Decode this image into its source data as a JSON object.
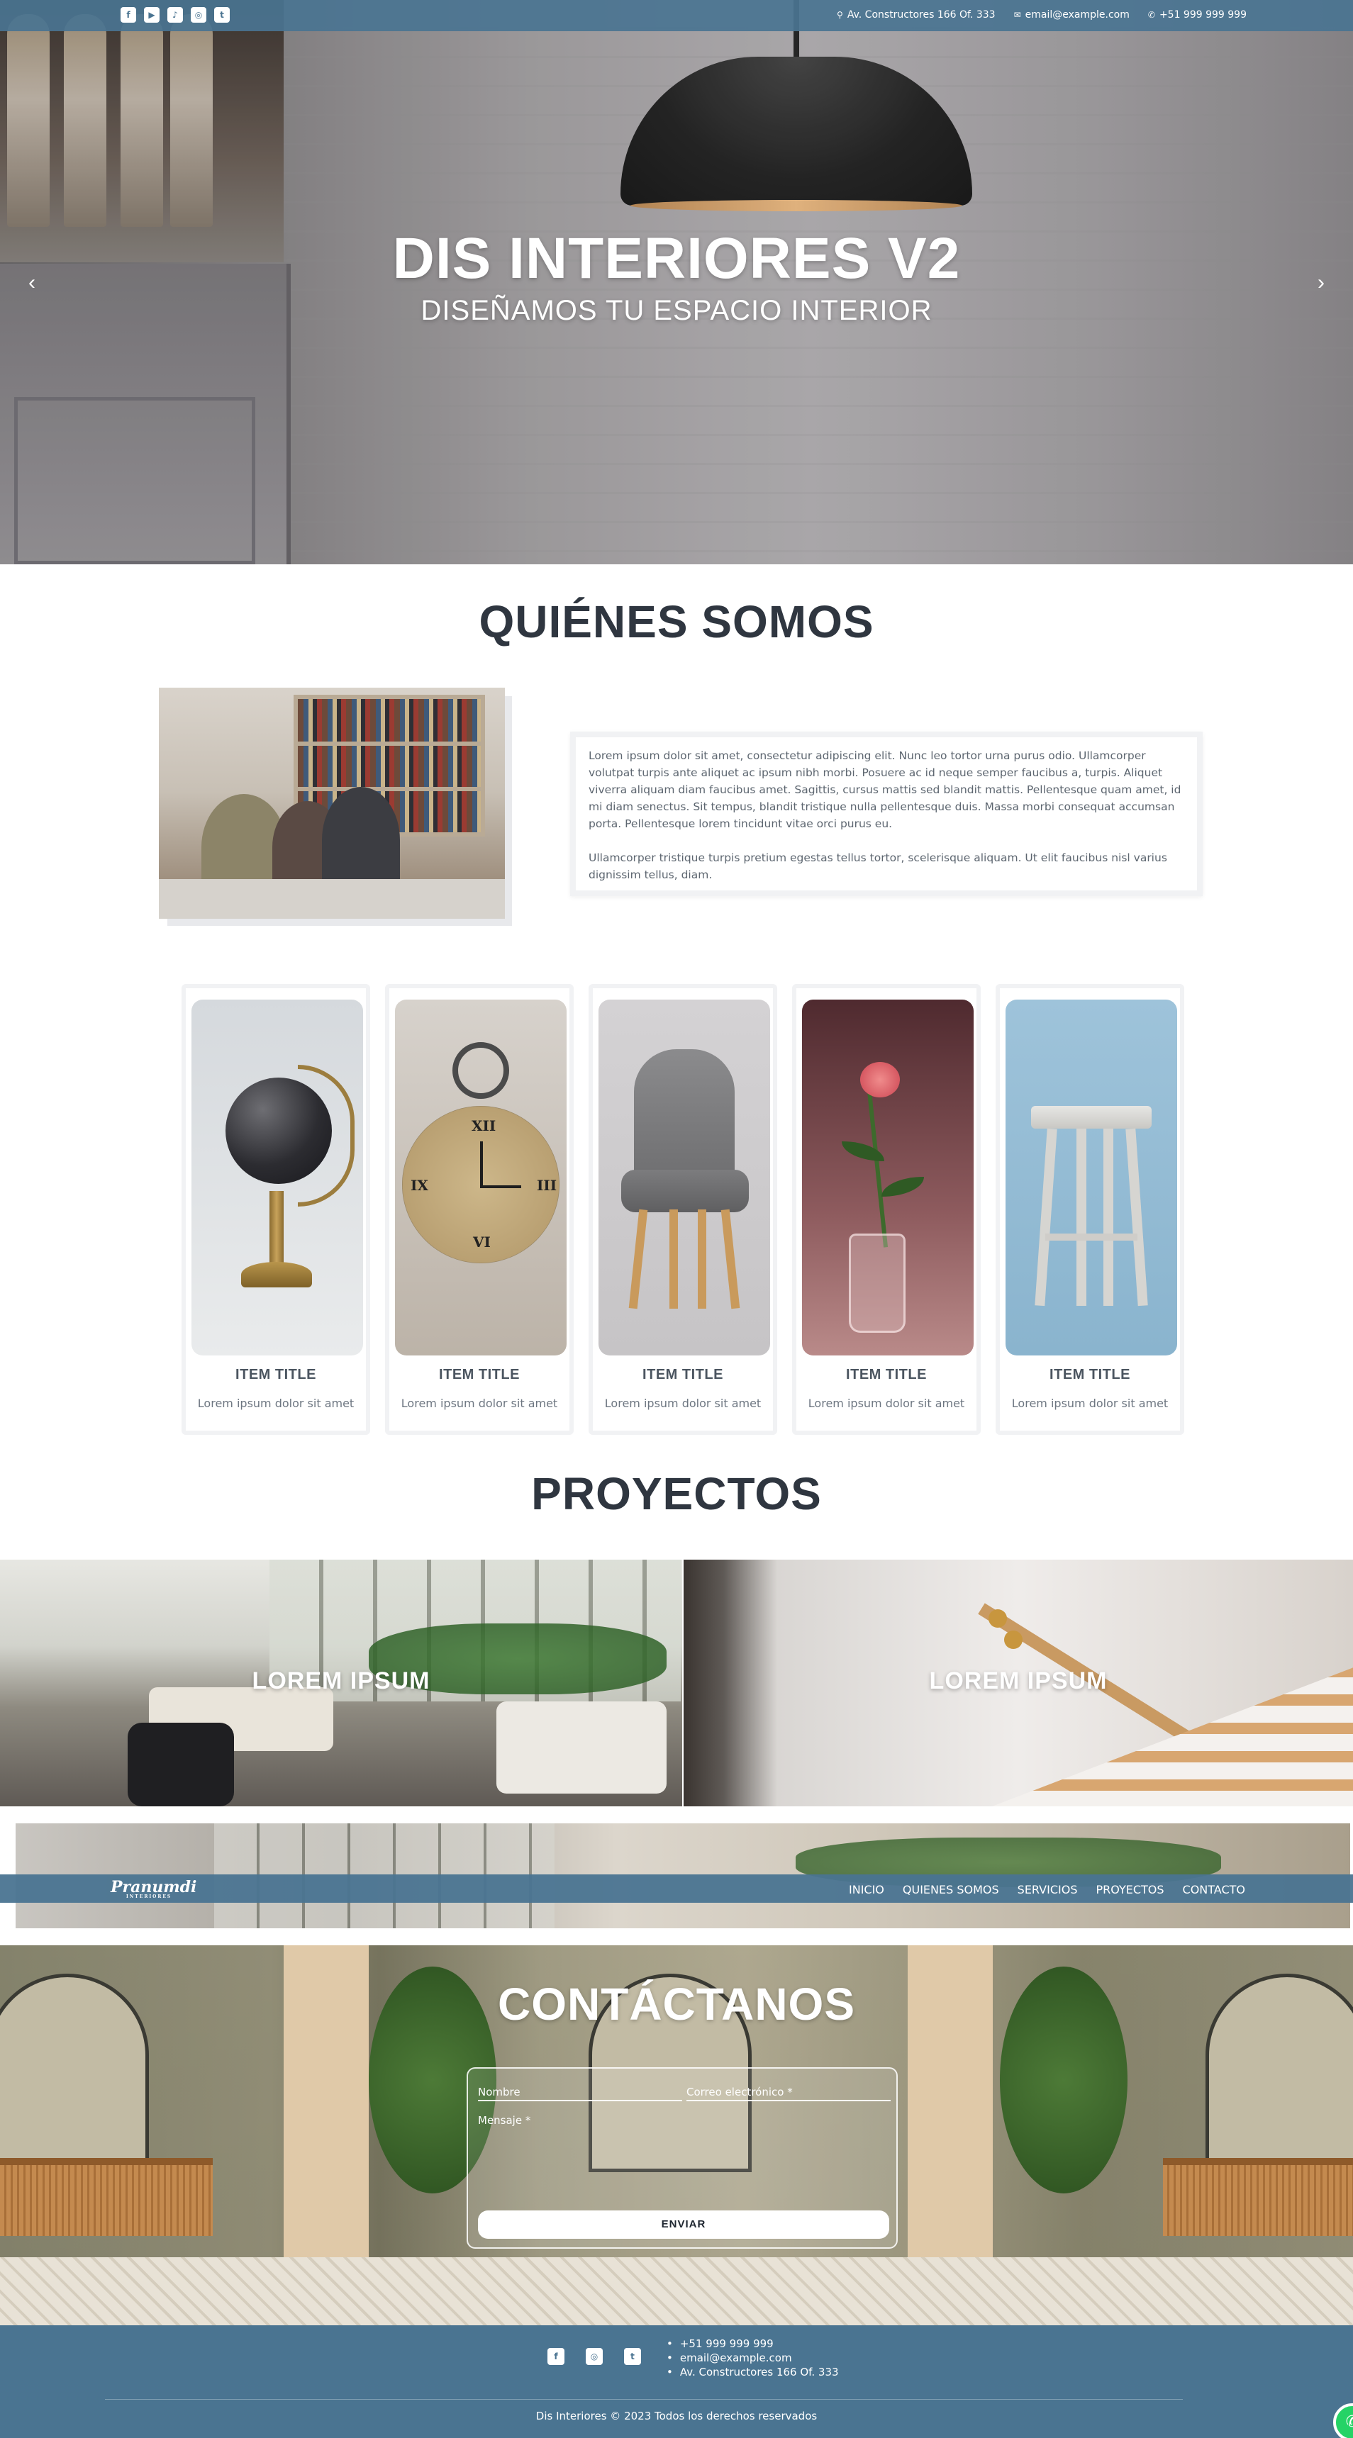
{
  "topbar": {
    "social": [
      {
        "icon": "facebook-icon",
        "glyph": "f"
      },
      {
        "icon": "youtube-icon",
        "glyph": "▶"
      },
      {
        "icon": "tiktok-icon",
        "glyph": "♪"
      },
      {
        "icon": "instagram-icon",
        "glyph": "◎"
      },
      {
        "icon": "twitter-icon",
        "glyph": "t"
      }
    ],
    "address": "Av. Constructores 166 Of. 333",
    "email": "email@example.com",
    "phone": "+51 999 999 999"
  },
  "hero": {
    "title": "DIS INTERIORES V2",
    "subtitle": "DISEÑAMOS TU ESPACIO INTERIOR",
    "prev": "‹",
    "next": "›"
  },
  "about": {
    "title": "QUIÉNES SOMOS",
    "paragraph_1": "Lorem ipsum dolor sit amet, consectetur adipiscing elit. Nunc leo tortor urna purus odio. Ullamcorper volutpat turpis ante aliquet ac ipsum nibh morbi. Posuere ac id neque semper faucibus a, turpis. Aliquet viverra aliquam diam faucibus amet. Sagittis, cursus mattis sed blandit mattis. Pellentesque quam amet, id mi diam senectus. Sit tempus, blandit tristique nulla pellentesque duis. Massa morbi consequat accumsan porta. Pellentesque lorem tincidunt vitae orci purus eu.",
    "paragraph_2": "Ullamcorper tristique turpis pretium egestas tellus tortor, scelerisque aliquam. Ut elit faucibus nisl varius dignissim tellus, diam."
  },
  "items": [
    {
      "title": "ITEM TITLE",
      "text": "Lorem ipsum dolor sit amet",
      "image": "globe"
    },
    {
      "title": "ITEM TITLE",
      "text": "Lorem ipsum dolor sit amet",
      "image": "alarm-clock"
    },
    {
      "title": "ITEM TITLE",
      "text": "Lorem ipsum dolor sit amet",
      "image": "chair"
    },
    {
      "title": "ITEM TITLE",
      "text": "Lorem ipsum dolor sit amet",
      "image": "rose"
    },
    {
      "title": "ITEM TITLE",
      "text": "Lorem ipsum dolor sit amet",
      "image": "stool"
    }
  ],
  "projects": {
    "title": "PROYECTOS",
    "tiles": [
      {
        "label": "LOREM IPSUM"
      },
      {
        "label": "LOREM IPSUM"
      }
    ]
  },
  "nav": {
    "logo": "Pranumdi",
    "logo_sub": "INTERIORES",
    "items": [
      "INICIO",
      "QUIENES SOMOS",
      "SERVICIOS",
      "PROYECTOS",
      "CONTACTO"
    ]
  },
  "contact": {
    "title": "CONTÁCTANOS",
    "name_placeholder": "Nombre",
    "email_placeholder": "Correo electrónico *",
    "message_placeholder": "Mensaje *",
    "submit": "ENVIAR"
  },
  "footer": {
    "social": [
      {
        "icon": "facebook-icon",
        "glyph": "f"
      },
      {
        "icon": "instagram-icon",
        "glyph": "◎"
      },
      {
        "icon": "twitter-icon",
        "glyph": "t"
      }
    ],
    "phone": "+51 999 999 999",
    "email": "email@example.com",
    "address": "Av. Constructores 166 Of. 333",
    "copyright": "Dis Interiores © 2023 Todos los derechos reservados"
  },
  "colors": {
    "brand": "#4a7491",
    "heading": "#2f3640"
  }
}
